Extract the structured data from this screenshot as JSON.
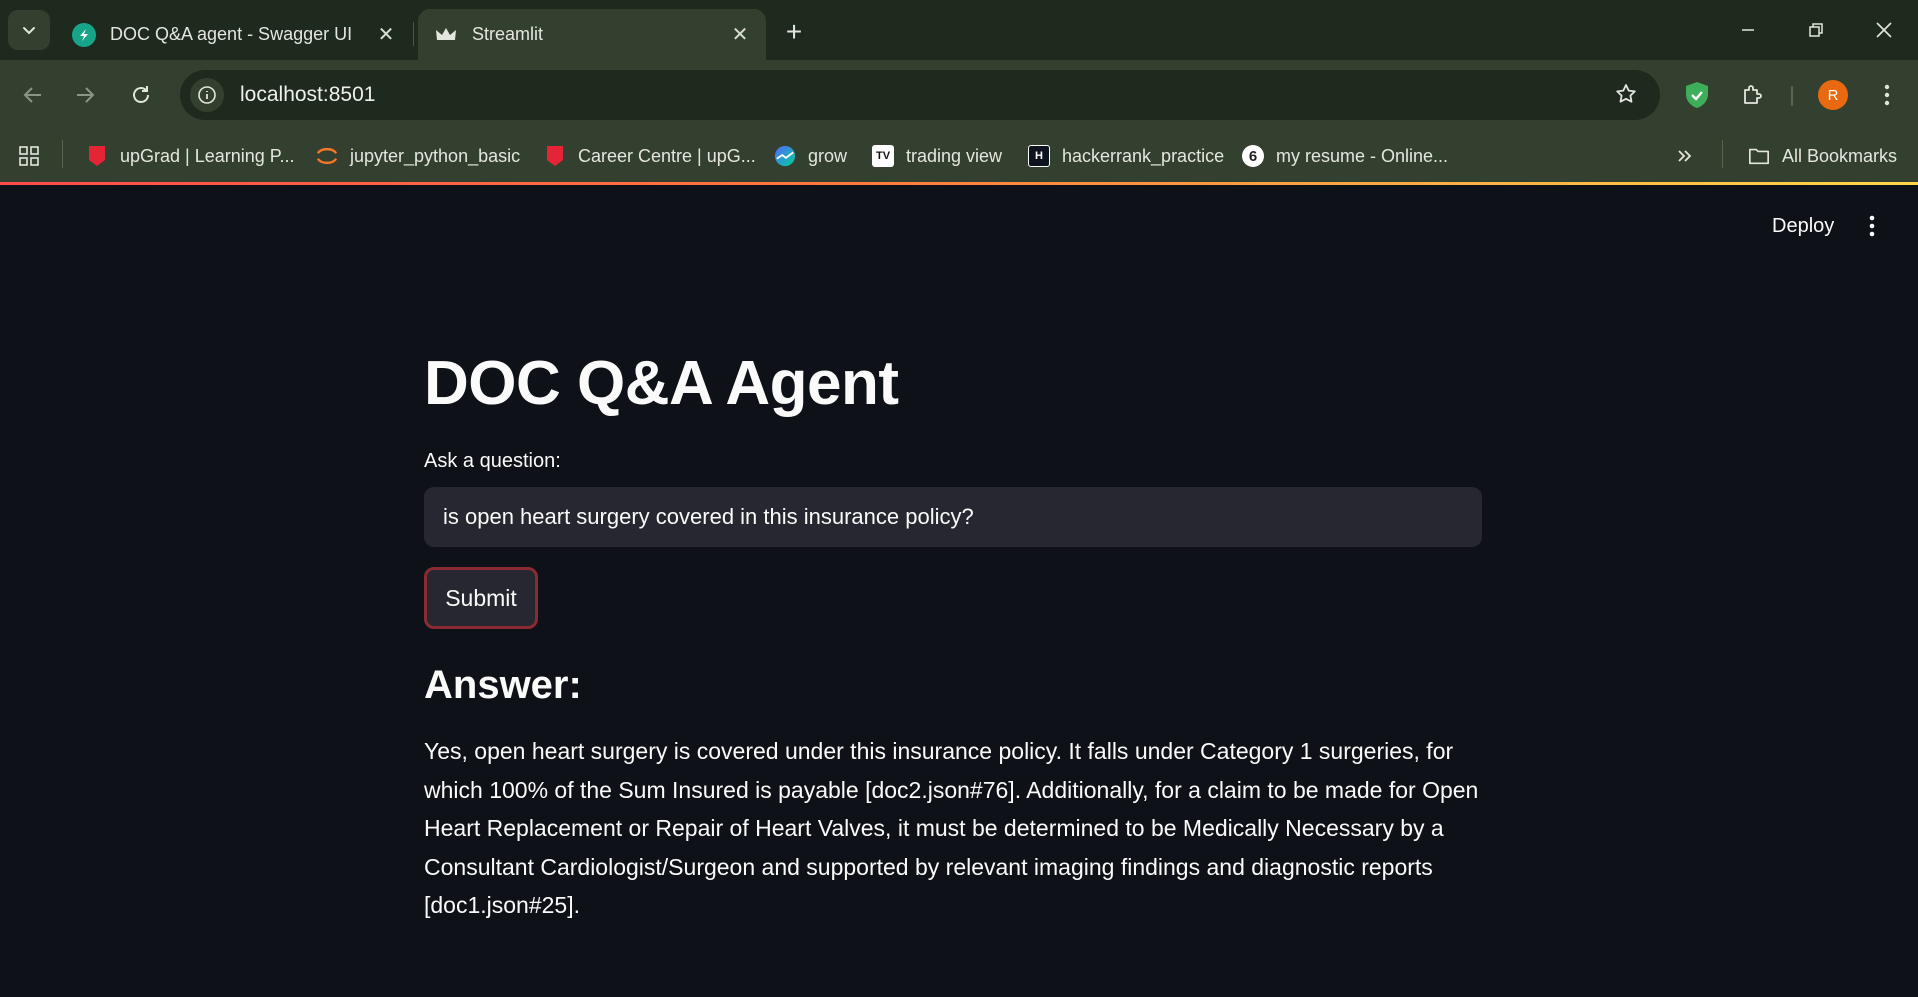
{
  "browser": {
    "tabs": [
      {
        "title": "DOC Q&A agent - Swagger UI",
        "active": false,
        "favicon": "swagger-icon"
      },
      {
        "title": "Streamlit",
        "active": true,
        "favicon": "streamlit-crown-icon"
      }
    ],
    "address": "localhost:8501",
    "profile_initial": "R",
    "bookmarks": [
      {
        "label": "upGrad | Learning P...",
        "icon": "upgrad-icon"
      },
      {
        "label": "jupyter_python_basic",
        "icon": "jupyter-icon"
      },
      {
        "label": "Career Centre | upG...",
        "icon": "upgrad-icon"
      },
      {
        "label": "grow",
        "icon": "grow-icon"
      },
      {
        "label": "trading view",
        "icon": "tradingview-icon"
      },
      {
        "label": "hackerrank_practice",
        "icon": "hackerrank-icon"
      },
      {
        "label": "my resume - Online...",
        "icon": "resume-icon"
      }
    ],
    "all_bookmarks": "All Bookmarks"
  },
  "app": {
    "deploy_label": "Deploy",
    "title": "DOC Q&A Agent",
    "question_label": "Ask a question:",
    "question_value": "is open heart surgery covered in this insurance policy?",
    "submit_label": "Submit",
    "answer_heading": "Answer:",
    "answer_text": "Yes, open heart surgery is covered under this insurance policy. It falls under Category 1 surgeries, for which 100% of the Sum Insured is payable [doc2.json#76]. Additionally, for a claim to be made for Open Heart Replacement or Repair of Heart Valves, it must be determined to be Medically Necessary by a Consultant Cardiologist/Surgeon and supported by relevant imaging findings and diagnostic reports [doc1.json#25]."
  },
  "colors": {
    "app_background": "#0e1117",
    "input_background": "#262730",
    "submit_border": "#8a2a32",
    "chrome_dark": "#1e2a1d",
    "chrome_light": "#34402f",
    "profile_avatar": "#e8690f"
  }
}
